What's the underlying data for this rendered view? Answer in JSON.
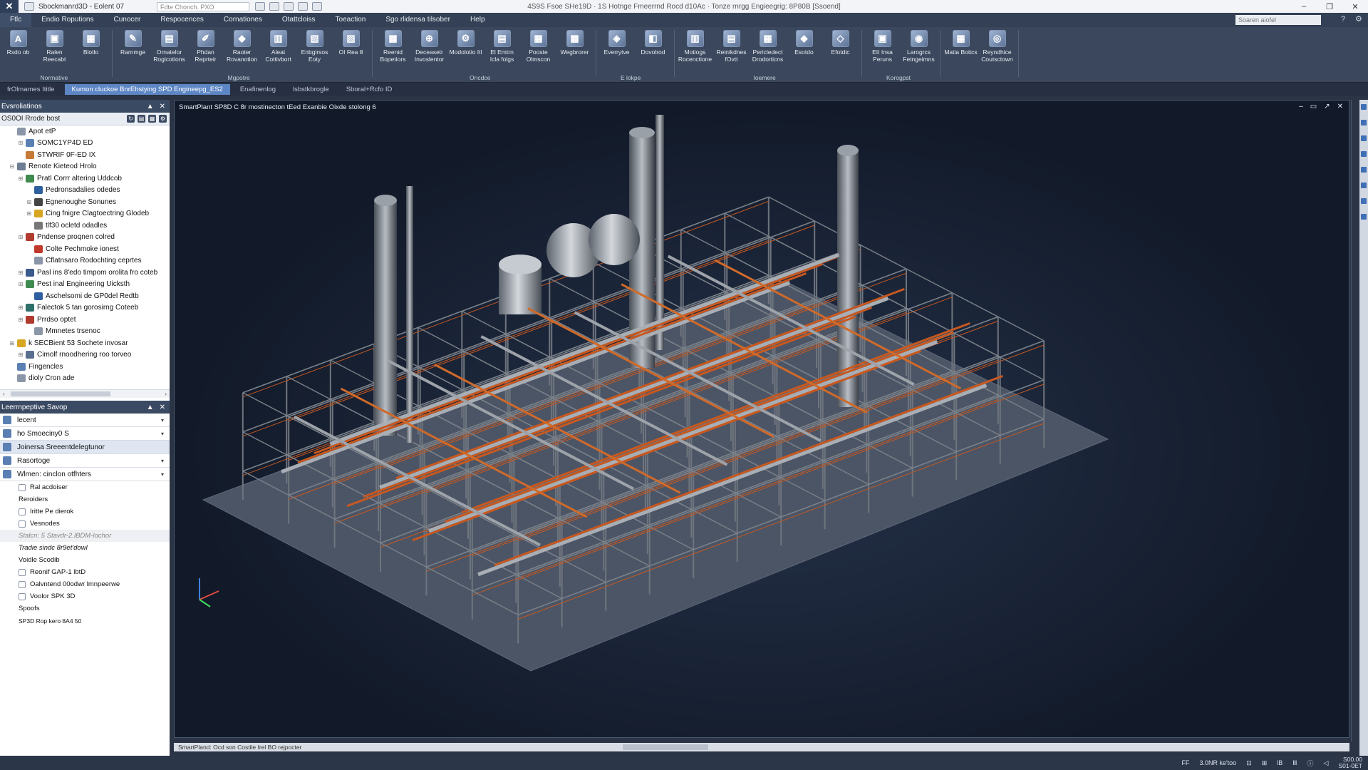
{
  "titlebar": {
    "app_name": "Sbockmanrd3D - Eolent 07",
    "file_box": "Fdte Chonch. PXO",
    "doc_title": "4S9S Fsoe SHe19D · 1S Hotnge Fmeerrnd Rocd d10Ac · Tonze rnrgg Engieegrig: 8P80B [Ssoend]",
    "controls": [
      "–",
      "❐",
      "✕"
    ]
  },
  "menu": {
    "items": [
      "Ftlc",
      "Endio Roputions",
      "Cunocer",
      "Respocences",
      "Cornationes",
      "Otattcloiss",
      "Toeaction",
      "Sgo rlidensa tilsober",
      "Help"
    ],
    "active_index": 0,
    "search_placeholder": "Soaren aiofel"
  },
  "ribbon": {
    "groups": [
      {
        "name": "Normative",
        "buttons": [
          {
            "label": "Rxdo ob",
            "icon": "A"
          },
          {
            "label": "Ralen Reecabt",
            "icon": "▣"
          },
          {
            "label": "Blotlo",
            "icon": "▦"
          }
        ]
      },
      {
        "name": "Mgpotre",
        "buttons": [
          {
            "label": "Rarnmge",
            "icon": "✎"
          },
          {
            "label": "Ornatelor Rogicotions",
            "icon": "▤"
          },
          {
            "label": "Phdan Reprteir",
            "icon": "✐"
          },
          {
            "label": "Raoter Rovanotion",
            "icon": "◆"
          },
          {
            "label": "Aleat Cottivbort",
            "icon": "▥"
          },
          {
            "label": "Enbgirsos Eoty",
            "icon": "▧"
          },
          {
            "label": "OI Rea 8",
            "icon": "▨"
          }
        ]
      },
      {
        "name": "Oncdce",
        "buttons": [
          {
            "label": "Reenid Bopetiors",
            "icon": "▩"
          },
          {
            "label": "Deceasetr Invoslentor",
            "icon": "⊕"
          },
          {
            "label": "Modolotio Itl",
            "icon": "⚙"
          },
          {
            "label": "El Emtrn Icla folgs",
            "icon": "▤"
          },
          {
            "label": "Pooste Olmscon",
            "icon": "▦"
          },
          {
            "label": "Wegbrorer",
            "icon": "▩"
          }
        ]
      },
      {
        "name": "E lokpe",
        "buttons": [
          {
            "label": "Everrytve",
            "icon": "◈"
          },
          {
            "label": "Dovolrod",
            "icon": "◧"
          }
        ]
      },
      {
        "name": "Ioemere",
        "buttons": [
          {
            "label": "Motiogs Rocenctione",
            "icon": "▥"
          },
          {
            "label": "Reinikdnes fOvtt",
            "icon": "▤"
          },
          {
            "label": "Pericledect Drodorticns",
            "icon": "▦"
          },
          {
            "label": "Esotdo",
            "icon": "◆"
          },
          {
            "label": "Efotdic",
            "icon": "◇"
          }
        ]
      },
      {
        "name": "Korogpst",
        "buttons": [
          {
            "label": "EII Insa Peruns",
            "icon": "▣"
          },
          {
            "label": "Larogrcs Fetngeimns",
            "icon": "◉"
          }
        ]
      },
      {
        "name": "",
        "buttons": [
          {
            "label": "Matia Botics",
            "icon": "▦"
          },
          {
            "label": "Reyndhice Coutsctown",
            "icon": "◎"
          }
        ]
      }
    ]
  },
  "doc_tabs": [
    "frOlmames Ititle",
    "Kumon cluckoe BnrEhstying SPD Engineepg_ES2",
    "Enafinenlog",
    "lsbstkbrogle",
    "Sboral+Rcfo ID"
  ],
  "doc_tabs_active": 1,
  "left_panel": {
    "tree_header": "Evsroliatinos",
    "tree_subheader": "OS0OI Rrode bost",
    "tree_items": [
      {
        "label": "Apot etP",
        "indent": 1,
        "expander": "",
        "color": "#8a96a8"
      },
      {
        "label": "SOMC1YP4D ED",
        "indent": 2,
        "expander": "⊞",
        "color": "#5a7fb3"
      },
      {
        "label": "STWRIF 0F-ED IX",
        "indent": 2,
        "expander": "",
        "color": "#c77a35"
      },
      {
        "label": "Renote Kieteod Hrolo",
        "indent": 1,
        "expander": "⊟",
        "color": "#6d7d94"
      },
      {
        "label": "Pratl Corrr altering Uddcob",
        "indent": 2,
        "expander": "⊞",
        "color": "#3e8a4f"
      },
      {
        "label": "Pedronsadalies odedes",
        "indent": 3,
        "expander": "",
        "color": "#2e5f9e"
      },
      {
        "label": "Egnenoughe Sonunes",
        "indent": 3,
        "expander": "⊞",
        "color": "#444"
      },
      {
        "label": "Cing fnigre Clagtoectring Glodeb",
        "indent": 3,
        "expander": "⊞",
        "color": "#d8a520"
      },
      {
        "label": "tlf30 ocletd odadles",
        "indent": 3,
        "expander": "",
        "color": "#777"
      },
      {
        "label": "Pndense proqnen colred",
        "indent": 2,
        "expander": "⊞",
        "color": "#b03a2e"
      },
      {
        "label": "Colte Pechmoke ionest",
        "indent": 3,
        "expander": "",
        "color": "#c0392b"
      },
      {
        "label": "Cflatnsaro Rodochting ceprtes",
        "indent": 3,
        "expander": "",
        "color": "#8a96a8"
      },
      {
        "label": "Pasl ins 8'edo timpom orolita fro coteb",
        "indent": 2,
        "expander": "⊞",
        "color": "#3a5a8c"
      },
      {
        "label": "Pest inal Engineering Uicksth",
        "indent": 2,
        "expander": "⊞",
        "color": "#3e8a4f"
      },
      {
        "label": "Aschelsomi de GP0del Redtb",
        "indent": 3,
        "expander": "",
        "color": "#2e5f9e"
      },
      {
        "label": "Falectok 5 tan gorosirng Coteeb",
        "indent": 2,
        "expander": "⊞",
        "color": "#2f6f6a"
      },
      {
        "label": "Prrdso optet",
        "indent": 2,
        "expander": "⊞",
        "color": "#b03a2e"
      },
      {
        "label": "Mmnetes trsenoc",
        "indent": 3,
        "expander": "",
        "color": "#8a96a8"
      },
      {
        "label": "k SECBient 53 Sochete invosar",
        "indent": 1,
        "expander": "⊞",
        "color": "#d8a520"
      },
      {
        "label": "Cimolf rnoodhering roo torveo",
        "indent": 2,
        "expander": "⊞",
        "color": "#5a6f8f"
      },
      {
        "label": "Fingencles",
        "indent": 1,
        "expander": "",
        "color": "#5a7fb3"
      },
      {
        "label": "dioly Cron ade",
        "indent": 1,
        "expander": "",
        "color": "#8a96a8"
      }
    ],
    "props_header": "Leerrnpeptive Savop",
    "props_rows": [
      {
        "label": "lecent",
        "dropdown": true,
        "selected": false
      },
      {
        "label": "ho Smoeciny0 S",
        "dropdown": true,
        "selected": false
      },
      {
        "label": "Joinersa Sreeentdelegtunor",
        "dropdown": false,
        "selected": true
      },
      {
        "label": "Rasortoge",
        "dropdown": true,
        "selected": false
      },
      {
        "label": "Wlmen: cinclon otfhters",
        "dropdown": true,
        "selected": false
      }
    ],
    "prop_list": [
      {
        "label": "Ral acdoiser",
        "icon": true,
        "style": ""
      },
      {
        "label": "Reroiders",
        "icon": false,
        "style": ""
      },
      {
        "label": "Iritte Pe dierok",
        "icon": true,
        "style": ""
      },
      {
        "label": "Vesnodes",
        "icon": true,
        "style": ""
      },
      {
        "label": "Stalcn: 5 Stavdr-2.lBDM-lochor",
        "icon": false,
        "style": "gray"
      },
      {
        "label": "Tradie sindc 8r9et'dowl",
        "icon": false,
        "style": "italic"
      },
      {
        "label": "Voidle Scodib",
        "icon": false,
        "style": ""
      },
      {
        "label": "Reonif GAP-1 lbtD",
        "icon": true,
        "style": ""
      },
      {
        "label": "Oalvntend 00odwr lmnpeerwe",
        "icon": true,
        "style": ""
      },
      {
        "label": "Voolor SPK 3D",
        "icon": true,
        "style": ""
      },
      {
        "label": "Spoofs",
        "icon": false,
        "style": ""
      },
      {
        "label": "SP3D Rop kero 8A4 50",
        "icon": false,
        "style": "small"
      }
    ]
  },
  "viewport": {
    "title": "SmartPlant SP8D C 8r mostinecton tEed Exanbie Oixde stolong 6",
    "controls": [
      "–",
      "▭",
      "↗",
      "✕"
    ],
    "status_text": "SmartPland: Ocd son Costile Irel BO rejpocter"
  },
  "statusbar": {
    "items": [
      "FF",
      "3.0NR ke'too",
      "⊡",
      "⊞",
      "lB",
      "Ⅲ",
      "ⓘ",
      "◁"
    ],
    "time": "S00.00",
    "date": "S01-0ET"
  },
  "colors": {
    "ribbon_bg": "#3a475c",
    "panel_header": "#3b4a63",
    "active_tab": "#5d86c5",
    "pipe_orange": "#c8581f",
    "steel_gray": "#8a9098"
  }
}
